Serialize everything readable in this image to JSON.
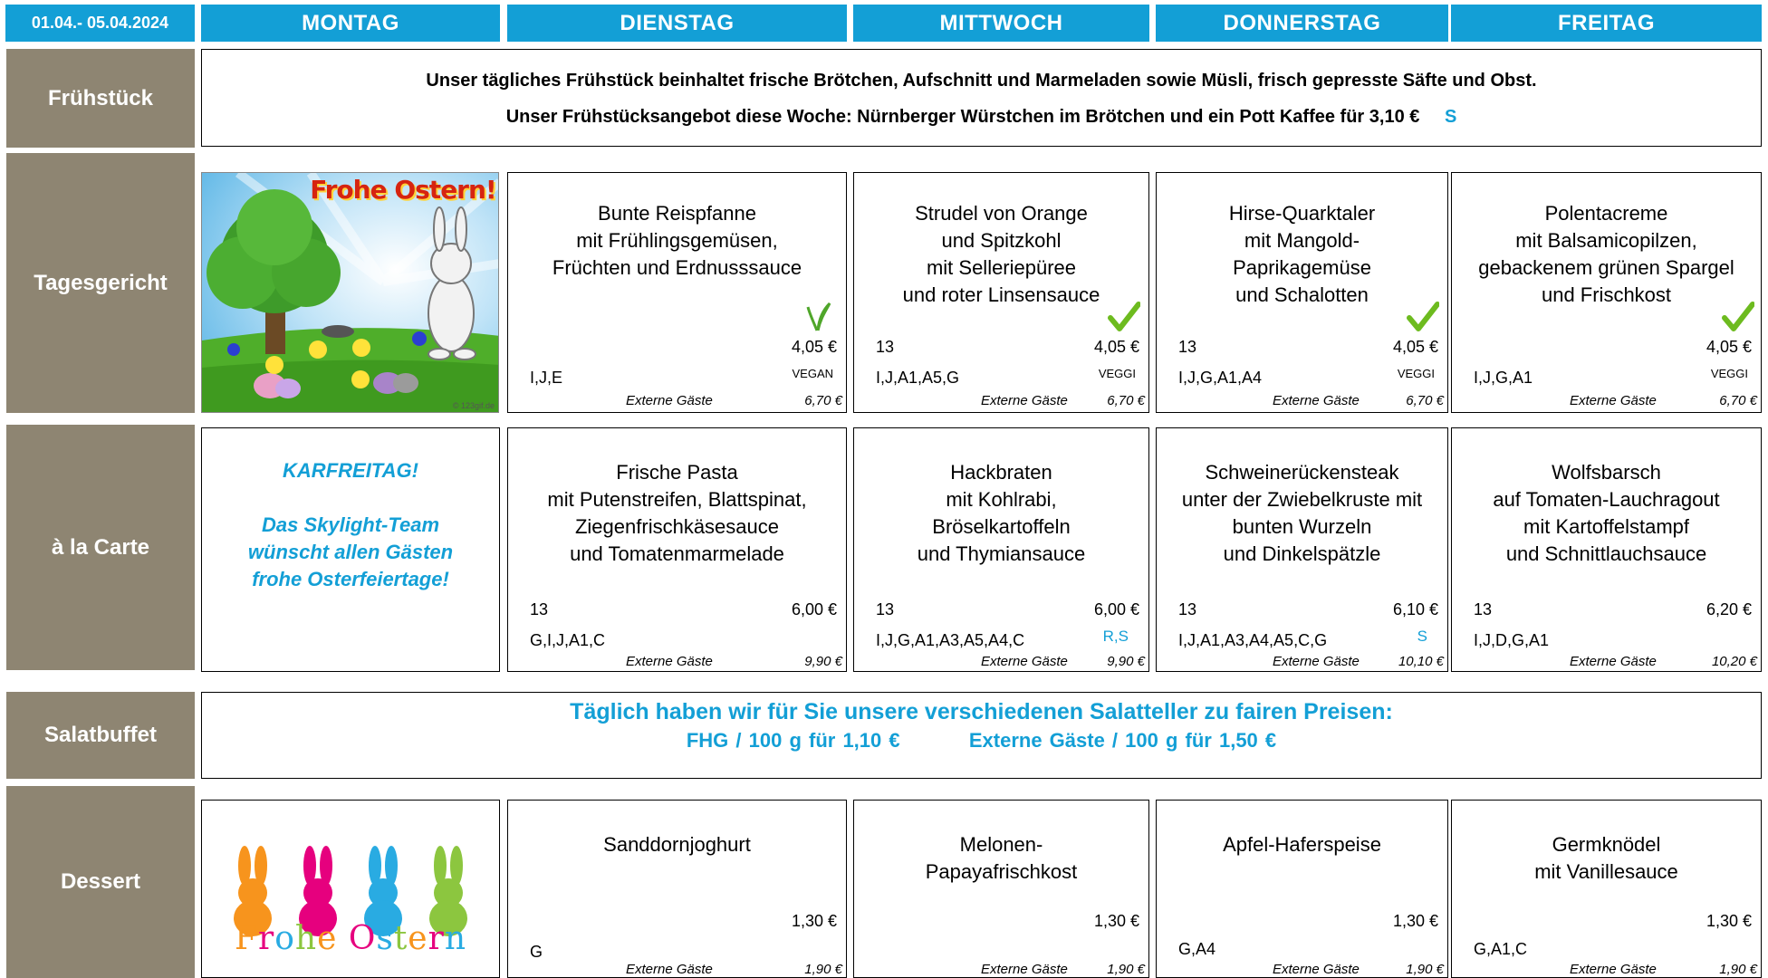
{
  "header": {
    "date_range": "01.04.- 05.04.2024",
    "days": [
      "MONTAG",
      "DIENSTAG",
      "MITTWOCH",
      "DONNERSTAG",
      "FREITAG"
    ]
  },
  "rows": {
    "fruehstueck": "Frühstück",
    "tagesgericht": "Tagesgericht",
    "alacarte": "à la Carte",
    "salatbuffet": "Salatbuffet",
    "dessert": "Dessert"
  },
  "breakfast": {
    "line1": "Unser tägliches Frühstück beinhaltet frische Brötchen, Aufschnitt und Marmeladen sowie Müsli, frisch gepresste Säfte und Obst.",
    "line2": "Unser Frühstücksangebot diese Woche:   Nürnberger Würstchen im Brötchen  und ein Pott Kaffee für  3,10   €",
    "badge": "S"
  },
  "easter_image": {
    "title": "Frohe Ostern!",
    "credit": "© 123gif.de"
  },
  "ext_label": "Externe Gäste",
  "tagesgericht": [
    {
      "dish": "Bunte Reispfanne\nmit Frühlingsgemüsen,\nFrüchten und Erdnusssauce",
      "code": "",
      "price": "4,05 €",
      "allergens": "I,J,E",
      "tag": "VEGAN",
      "ext_price": "6,70 €",
      "icon": "leaf-icon"
    },
    {
      "dish": "Strudel von Orange\nund Spitzkohl\nmit Selleriepüree\nund roter Linsensauce",
      "code": "13",
      "price": "4,05 €",
      "allergens": "I,J,A1,A5,G",
      "tag": "VEGGI",
      "ext_price": "6,70 €",
      "icon": "checkmark-icon"
    },
    {
      "dish": "Hirse-Quarktaler\nmit Mangold-\nPaprikagemüse\nund Schalotten",
      "code": "13",
      "price": "4,05 €",
      "allergens": "I,J,G,A1,A4",
      "tag": "VEGGI",
      "ext_price": "6,70 €",
      "icon": "checkmark-icon"
    },
    {
      "dish": "Polentacreme\nmit Balsamicopilzen,\ngebackenem grünen Spargel\nund Frischkost",
      "code": "",
      "price": "4,05 €",
      "allergens": "I,J,G,A1",
      "tag": "VEGGI",
      "ext_price": "6,70 €",
      "icon": "checkmark-icon"
    }
  ],
  "announcement": {
    "line1": "KARFREITAG!",
    "line2": "Das Skylight-Team",
    "line3": "wünscht allen Gästen",
    "line4": "frohe Osterfeiertage!"
  },
  "alacarte": [
    {
      "dish": "Frische Pasta\nmit Putenstreifen, Blattspinat,\nZiegenfrischkäsesauce\nund Tomatenmarmelade",
      "code": "13",
      "price": "6,00 €",
      "allergens": "G,I,J,A1,C",
      "tag": "",
      "ext_price": "9,90 €"
    },
    {
      "dish": "Hackbraten\nmit Kohlrabi,\nBröselkartoffeln\nund Thymiansauce",
      "code": "13",
      "price": "6,00 €",
      "allergens": "I,J,G,A1,A3,A5,A4,C",
      "tag": "R,S",
      "ext_price": "9,90 €"
    },
    {
      "dish": "Schweinerückensteak\nunter der Zwiebelkruste mit\nbunten Wurzeln\nund Dinkelspätzle",
      "code": "13",
      "price": "6,10 €",
      "allergens": "I,J,A1,A3,A4,A5,C,G",
      "tag": "S",
      "ext_price": "10,10 €"
    },
    {
      "dish": "Wolfsbarsch\nauf Tomaten-Lauchragout\nmit Kartoffelstampf\nund Schnittlauchsauce",
      "code": "13",
      "price": "6,20 €",
      "allergens": "I,J,D,G,A1",
      "tag": "",
      "ext_price": "10,20 €"
    }
  ],
  "salad": {
    "line1": "Täglich haben wir für Sie unsere verschiedenen Salatteller zu fairen Preisen:",
    "fhg": "FHG / 100 g für 1,10 €",
    "ext": "Externe Gäste / 100 g für 1,50 €"
  },
  "dessert_image": {
    "text": "Frohe Ostern",
    "bunny_colors": [
      "#f7941d",
      "#e6007e",
      "#29abe2",
      "#8cc63f"
    ]
  },
  "dessert": [
    {
      "dish": "Sanddornjoghurt",
      "price": "1,30 €",
      "allergens": "G",
      "ext_price": "1,90 €"
    },
    {
      "dish": "Melonen-\nPapayafrischkost",
      "price": "1,30 €",
      "allergens": "",
      "ext_price": "1,90 €"
    },
    {
      "dish": "Apfel-Haferspeise",
      "price": "1,30 €",
      "allergens": "G,A4",
      "ext_price": "1,90 €"
    },
    {
      "dish": "Germknödel\nmit Vanillesauce",
      "price": "1,30 €",
      "allergens": "G,A1,C",
      "ext_price": "1,90 €"
    }
  ],
  "colors": {
    "header_blue": "#139fd6",
    "label_taupe": "#8e8572",
    "check_green": "#6dbb1f"
  }
}
